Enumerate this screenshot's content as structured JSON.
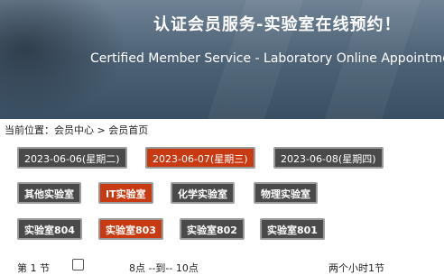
{
  "header": {
    "title": "认证会员服务-实验室在线预约！",
    "subtitle": "Certified Member Service - Laboratory Online Appointment"
  },
  "breadcrumb": "当前位置：会员中心 > 会员首页",
  "dates": [
    {
      "label": "2023-06-06(星期二)",
      "active": false
    },
    {
      "label": "2023-06-07(星期三)",
      "active": true
    },
    {
      "label": "2023-06-08(星期四)",
      "active": false
    }
  ],
  "lab_types": [
    {
      "label": "其他实验室",
      "active": false
    },
    {
      "label": "IT实验室",
      "active": true
    },
    {
      "label": "化学实验室",
      "active": false
    },
    {
      "label": "物理实验室",
      "active": false
    }
  ],
  "rooms": [
    {
      "label": "实验室804",
      "active": false
    },
    {
      "label": "实验室803",
      "active": true
    },
    {
      "label": "实验室802",
      "active": false
    },
    {
      "label": "实验室801",
      "active": false
    }
  ],
  "sessions": [
    {
      "name": "第 1 节",
      "time": "8点 --到-- 10点",
      "duration": "两个小时1节",
      "checked": false
    }
  ],
  "colors": {
    "active": "#c83b12",
    "inactive": "#4a4a4a",
    "border": "#9c9c9c"
  }
}
